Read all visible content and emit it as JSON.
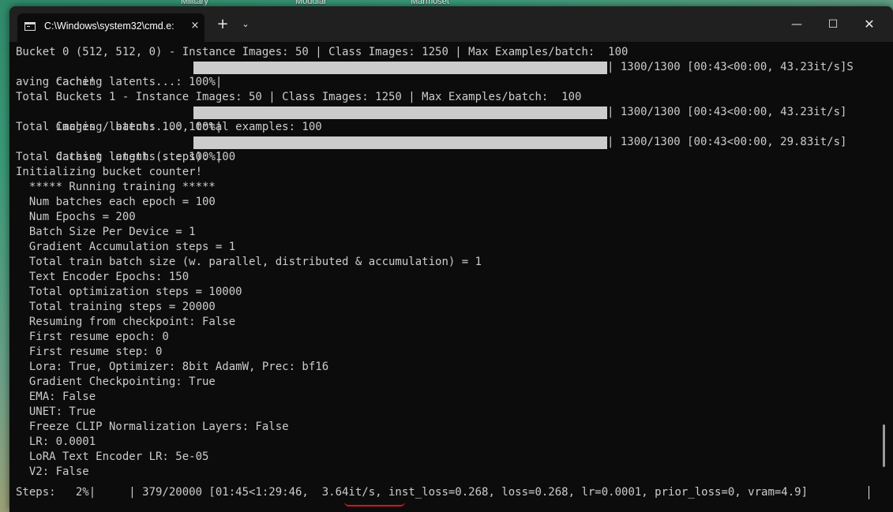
{
  "desktop": {
    "labels": [
      "Military",
      "Modular",
      "Marmoset"
    ]
  },
  "window": {
    "tab_title": "C:\\Windows\\system32\\cmd.e:",
    "close_tab": "×",
    "new_tab": "+",
    "dropdown": "⌄",
    "minimize": "—",
    "maximize": "☐",
    "close": "✕"
  },
  "console": {
    "lines": [
      "Bucket 0 (512, 512, 0) - Instance Images: 50 | Class Images: 1250 | Max Examples/batch:  100",
      "Caching latents...: 100%|",
      "aving cache!",
      "Total Buckets 1 - Instance Images: 50 | Class Images: 1250 | Max Examples/batch:  100",
      "Caching latents...: 100%|",
      "Total images / batch: 100, total examples: 100",
      "Caching latents...: 100%|",
      "Total dataset length (steps): 100",
      "Initializing bucket counter!",
      "  ***** Running training *****",
      "  Num batches each epoch = 100",
      "  Num Epochs = 200",
      "  Batch Size Per Device = 1",
      "  Gradient Accumulation steps = 1",
      "  Total train batch size (w. parallel, distributed & accumulation) = 1",
      "  Text Encoder Epochs: 150",
      "  Total optimization steps = 10000",
      "  Total training steps = 20000",
      "  Resuming from checkpoint: False",
      "  First resume epoch: 0",
      "  First resume step: 0",
      "  Lora: True, Optimizer: 8bit AdamW, Prec: bf16",
      "  Gradient Checkpointing: True",
      "  EMA: False",
      "  UNET: True",
      "  Freeze CLIP Normalization Layers: False",
      "  LR: 0.0001",
      "  LoRA Text Encoder LR: 5e-05",
      "  V2: False"
    ],
    "progress_suffixes": [
      "| 1300/1300 [00:43<00:00, 43.23it/s]S",
      "| 1300/1300 [00:43<00:00, 43.23it/s]",
      "| 1300/1300 [00:43<00:00, 29.83it/s]"
    ],
    "progress_percent": 100,
    "steps_line": "Steps:   2%|     | 379/20000 [01:45<1:29:46,  3.64it/s, inst_loss=0.268, loss=0.268, lr=0.0001, prior_loss=0, vram=4.9]",
    "steps_percent": 2
  }
}
